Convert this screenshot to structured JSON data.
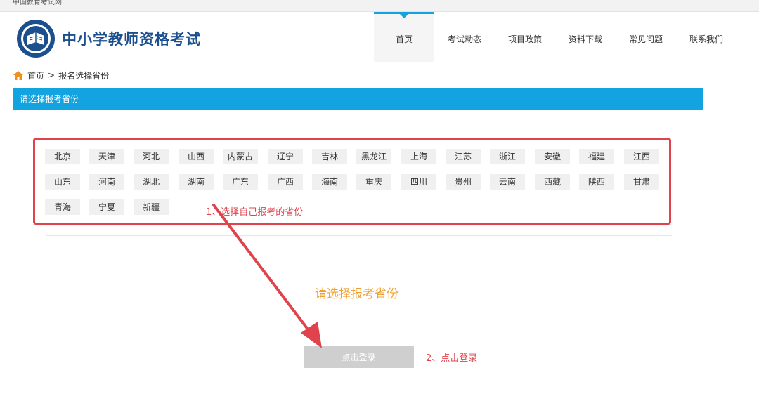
{
  "top_strip": {
    "text": "中国教育考试网"
  },
  "header": {
    "site_title": "中小学教师资格考试",
    "nav": [
      "首页",
      "考试动态",
      "项目政策",
      "资料下载",
      "常见问题",
      "联系我们"
    ]
  },
  "breadcrumb": {
    "home": "首页",
    "separator": ">",
    "current": "报名选择省份"
  },
  "title_bar": "请选择报考省份",
  "provinces": [
    [
      "北京",
      "天津",
      "河北",
      "山西",
      "内蒙古",
      "辽宁",
      "吉林",
      "黑龙江",
      "上海",
      "江苏",
      "浙江",
      "安徽",
      "福建",
      "江西"
    ],
    [
      "山东",
      "河南",
      "湖北",
      "湖南",
      "广东",
      "广西",
      "海南",
      "重庆",
      "四川",
      "贵州",
      "云南",
      "西藏",
      "陕西",
      "甘肃"
    ],
    [
      "青海",
      "宁夏",
      "新疆"
    ]
  ],
  "annotations": {
    "step1": "1、选择自己报考的省份",
    "step2": "2、点击登录"
  },
  "prompt": "请选择报考省份",
  "login_button": "点击登录",
  "colors": {
    "accent": "#12a3e0",
    "annotation": "#e0434b",
    "prompt": "#f0a030",
    "title": "#1b4f8e"
  }
}
